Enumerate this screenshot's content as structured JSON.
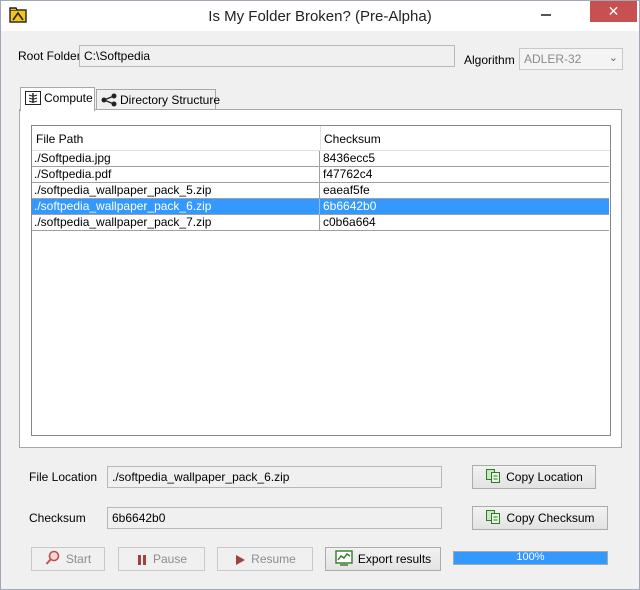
{
  "window": {
    "title": "Is My Folder Broken? (Pre-Alpha)",
    "close_glyph": "✕"
  },
  "root_folder": {
    "label": "Root Folder",
    "value": "C:\\Softpedia"
  },
  "algorithm": {
    "label": "Algorithm",
    "value": "ADLER-32",
    "arrow": "⌄"
  },
  "tabs": [
    {
      "label": "Compute",
      "icon": "x-ray-icon",
      "active": true
    },
    {
      "label": "Directory Structure",
      "icon": "tree-icon",
      "active": false
    }
  ],
  "table": {
    "columns": [
      "File Path",
      "Checksum"
    ],
    "rows": [
      {
        "path": "./Softpedia.jpg",
        "checksum": "8436ecc5"
      },
      {
        "path": "./Softpedia.pdf",
        "checksum": "f47762c4"
      },
      {
        "path": "./softpedia_wallpaper_pack_5.zip",
        "checksum": "eaeaf5fe"
      },
      {
        "path": "./softpedia_wallpaper_pack_6.zip",
        "checksum": "6b6642b0"
      },
      {
        "path": "./softpedia_wallpaper_pack_7.zip",
        "checksum": "c0b6a664"
      }
    ],
    "selected_index": 3
  },
  "file_location": {
    "label": "File Location",
    "value": "./softpedia_wallpaper_pack_6.zip"
  },
  "checksum": {
    "label": "Checksum",
    "value": "6b6642b0"
  },
  "buttons": {
    "copy_location": "Copy Location",
    "copy_checksum": "Copy Checksum",
    "start": "Start",
    "pause": "Pause",
    "resume": "Resume",
    "export": "Export results"
  },
  "progress": {
    "value": 100,
    "label": "100%"
  },
  "colors": {
    "selection": "#3399ff",
    "close": "#c75050",
    "progress": "#3399ff"
  }
}
